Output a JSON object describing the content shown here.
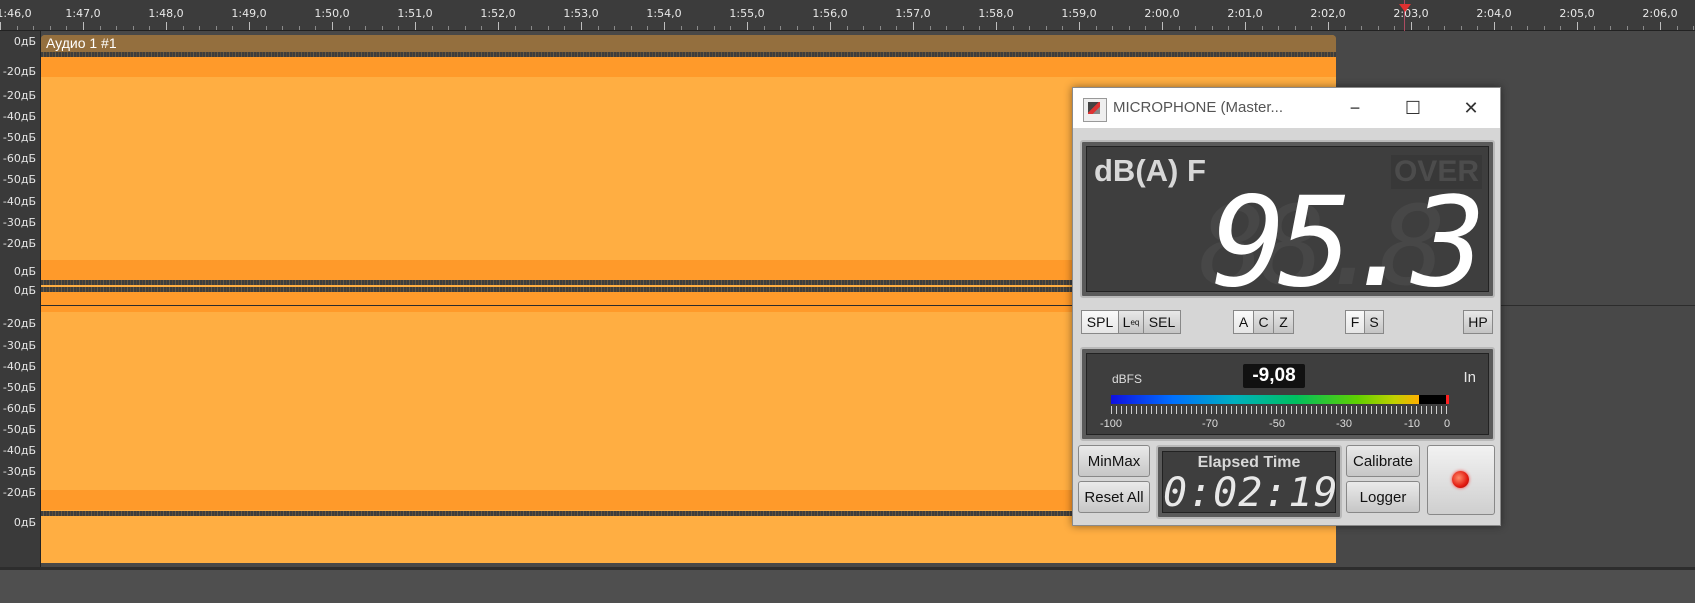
{
  "timeline": {
    "ticks": [
      "1:46,0",
      "1:47,0",
      "1:48,0",
      "1:49,0",
      "1:50,0",
      "1:51,0",
      "1:52,0",
      "1:53,0",
      "1:54,0",
      "1:55,0",
      "1:56,0",
      "1:57,0",
      "1:58,0",
      "1:59,0",
      "2:00,0",
      "2:01,0",
      "2:02,0",
      "2:03,0",
      "2:04,0",
      "2:05,0",
      "2:06,0"
    ],
    "playhead_time": "2:03,0"
  },
  "track": {
    "clip_title": "Аудио 1 #1",
    "scale_top": [
      "0дБ",
      "-20дБ",
      "-20дБ",
      "-40дБ",
      "-50дБ",
      "-60дБ",
      "-50дБ",
      "-40дБ",
      "-30дБ",
      "-20дБ",
      "0дБ"
    ],
    "scale_bottom": [
      "0дБ",
      "-20дБ",
      "-30дБ",
      "-40дБ",
      "-50дБ",
      "-60дБ",
      "-50дБ",
      "-40дБ",
      "-30дБ",
      "-20дБ",
      "0дБ"
    ],
    "waveform_color": "#ffae42"
  },
  "slm": {
    "title": "MICROPHONE (Master...",
    "minimize_icon": "−",
    "maximize_icon": "☐",
    "close_icon": "✕",
    "mode": "dB(A) F",
    "over_label": "OVER",
    "reading": "95.3",
    "buttons": {
      "spl": "SPL",
      "leq": "L",
      "leq_sub": "eq",
      "sel": "SEL",
      "a": "A",
      "c": "C",
      "z": "Z",
      "f": "F",
      "s": "S",
      "hp": "HP"
    },
    "meter": {
      "unit": "dBFS",
      "value": "-9,08",
      "channel": "In",
      "scale": [
        "-100",
        "-70",
        "-50",
        "-30",
        "-10",
        "0"
      ],
      "level_fraction": 0.91
    },
    "minmax": "MinMax",
    "reset_all": "Reset All",
    "elapsed_label": "Elapsed Time",
    "elapsed_value": "0:02:19",
    "calibrate": "Calibrate",
    "logger": "Logger",
    "record_color": "#e21a10"
  }
}
